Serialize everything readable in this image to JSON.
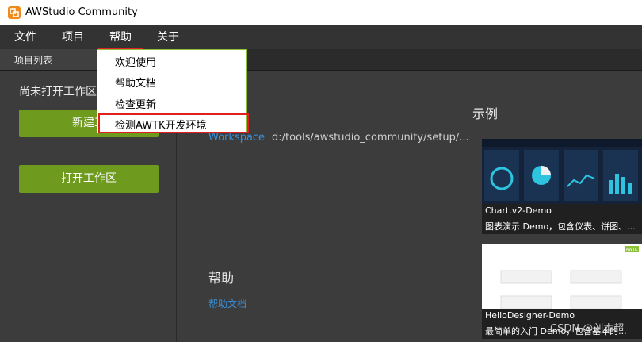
{
  "window": {
    "title": "AWStudio Community"
  },
  "menubar": {
    "file": "文件",
    "project": "项目",
    "help": "帮助",
    "about": "关于"
  },
  "tabs": {
    "project_list": "项目列表"
  },
  "left_panel": {
    "no_workspace": "尚未打开工作区",
    "new_workspace_visible": "新建工",
    "open_workspace": "打开工作区"
  },
  "help_menu": {
    "welcome": "欢迎使用",
    "docs": "帮助文档",
    "check_update": "检查更新",
    "check_env": "检测AWTK开发环境"
  },
  "main": {
    "workspace_label": "Workspace",
    "workspace_path": "d:/tools/awstudio_community/setup/...",
    "help_heading": "帮助",
    "help_doc_link": "帮助文档",
    "examples_heading": "示例"
  },
  "examples": [
    {
      "title": "Chart.v2-Demo",
      "desc": "图表演示 Demo，包含仪表、饼图、..."
    },
    {
      "title": "HelloDesigner-Demo",
      "desc": "最简单的入门 Demo，包含基本的..."
    }
  ],
  "thumb2": {
    "tag": "AWTK"
  },
  "watermark": "CSDN @刘本超",
  "colors": {
    "accent_green": "#6e9a1e",
    "link_blue": "#3a8fd8",
    "highlight_red": "#e02020"
  }
}
